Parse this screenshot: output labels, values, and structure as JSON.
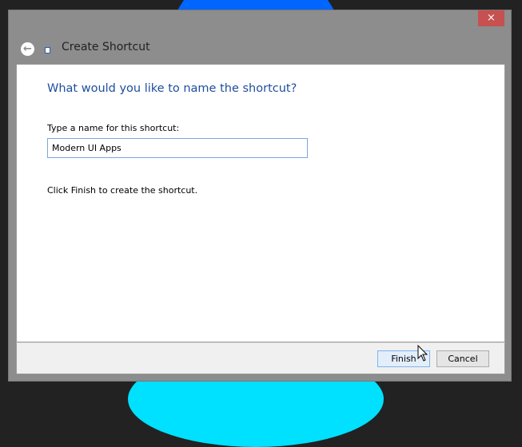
{
  "window": {
    "title": "Create Shortcut",
    "close_label": "×"
  },
  "main": {
    "heading": "What would you like to name the shortcut?",
    "name_label": "Type a name for this shortcut:",
    "name_value": "Modern UI Apps",
    "hint": "Click Finish to create the shortcut."
  },
  "footer": {
    "finish_label": "Finish",
    "cancel_label": "Cancel"
  }
}
